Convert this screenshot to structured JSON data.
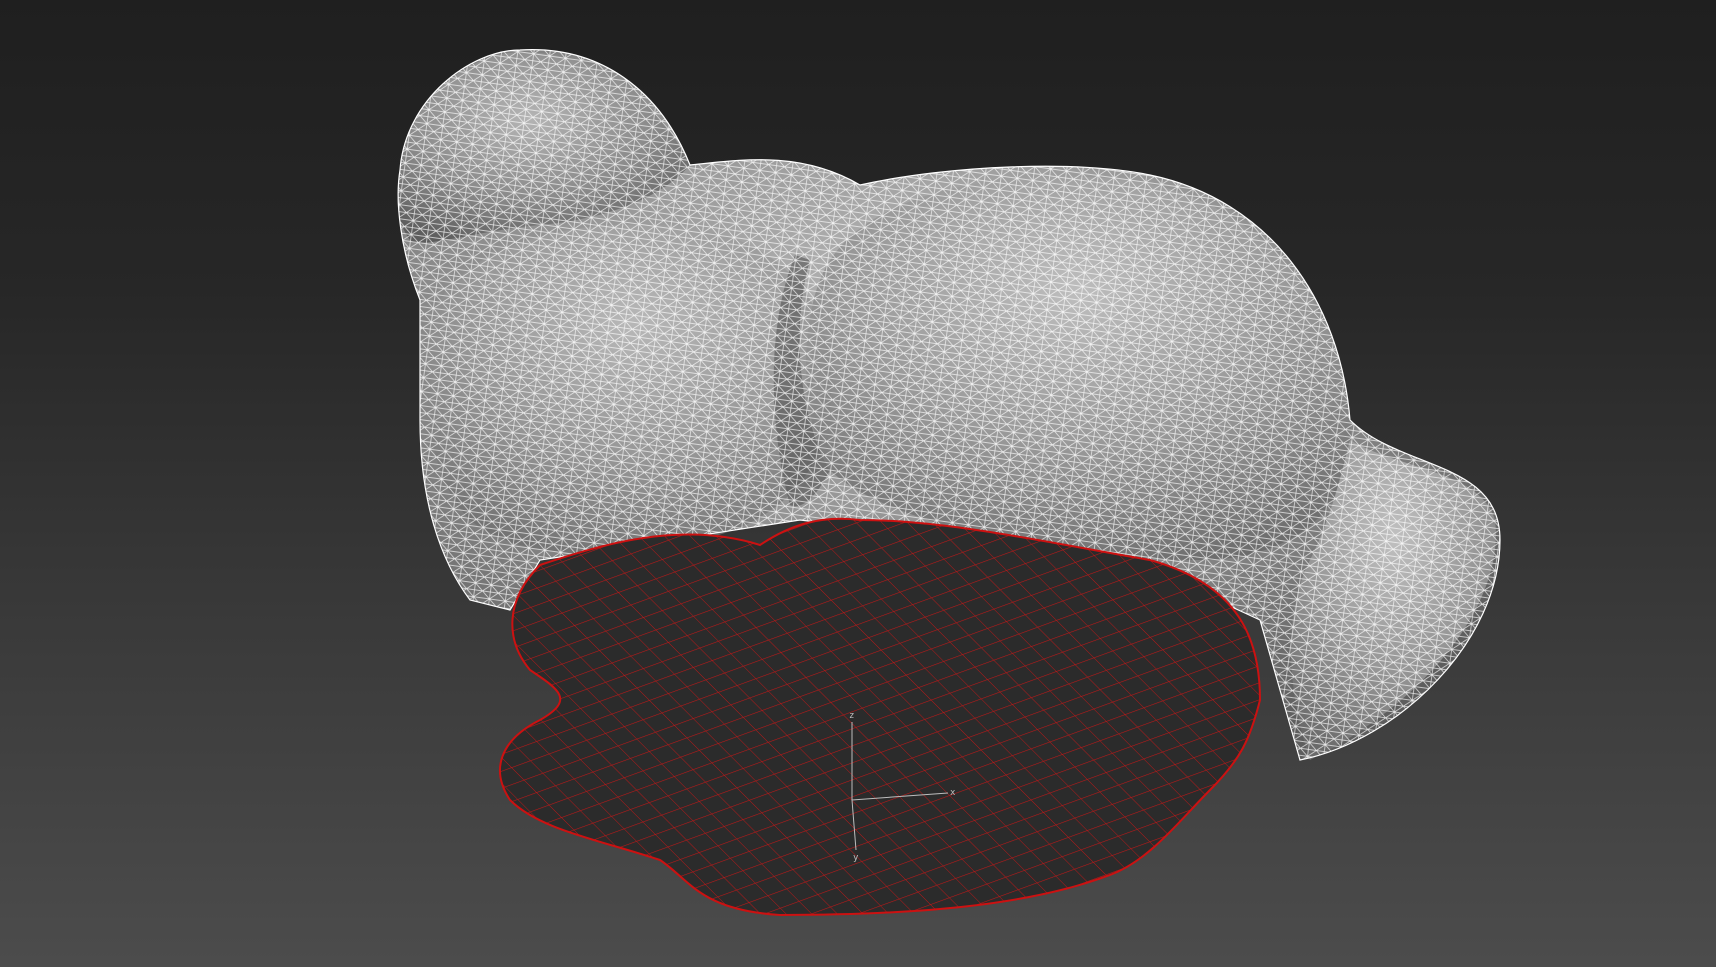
{
  "viewport": {
    "background_top": "#1f1f1f",
    "background_bottom": "#4c4c4c",
    "mesh_color": "#8f8f8f",
    "wireframe_color": "#ffffff",
    "selection_color": "#cc1111",
    "selection_fill": "#2b2b2b"
  },
  "gizmo": {
    "axes": [
      {
        "name": "z",
        "label": "z",
        "color": "#bdbdbd"
      },
      {
        "name": "x",
        "label": "x",
        "color": "#bdbdbd"
      },
      {
        "name": "y",
        "label": "y",
        "color": "#bdbdbd"
      }
    ]
  }
}
